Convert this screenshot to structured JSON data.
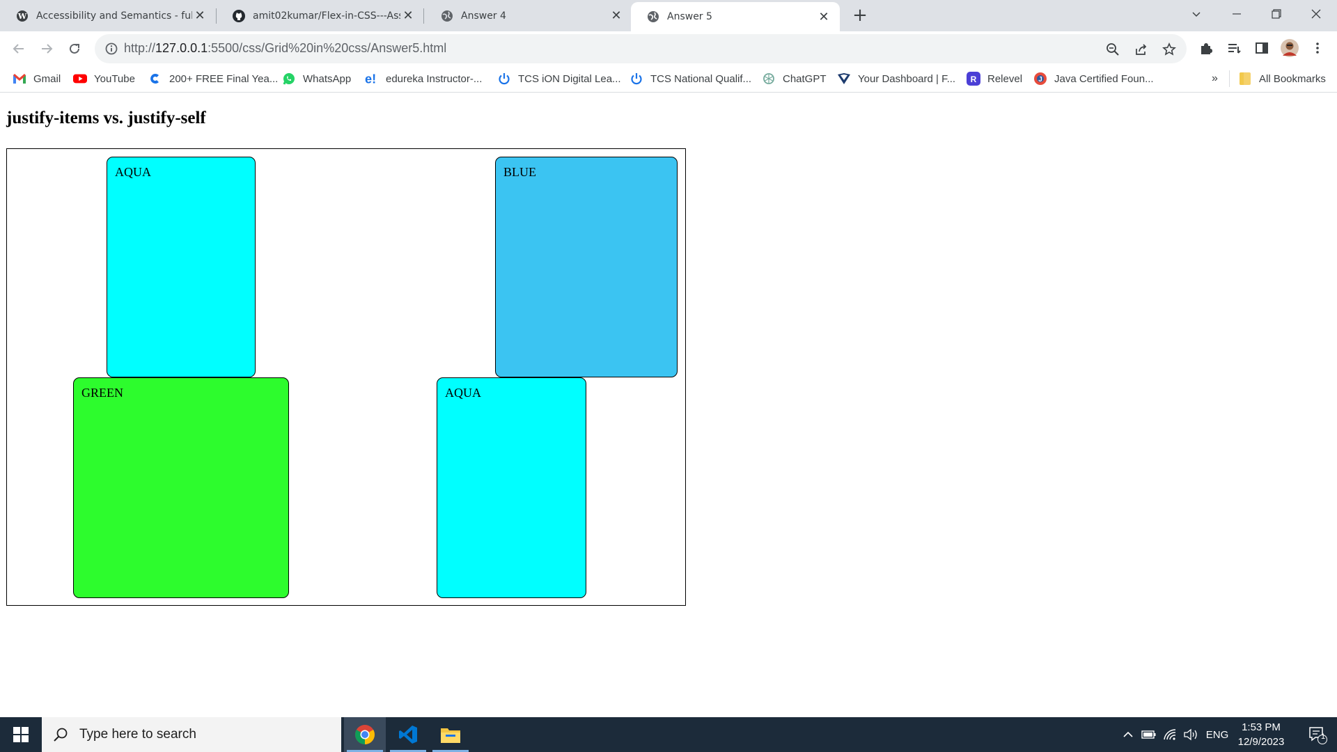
{
  "browser": {
    "tabs": [
      {
        "title": "Accessibility and Semantics - full",
        "favicon": "wordpress-icon",
        "active": false
      },
      {
        "title": "amit02kumar/Flex-in-CSS---Ass",
        "favicon": "github-icon",
        "active": false
      },
      {
        "title": "Answer 4",
        "favicon": "globe-icon",
        "active": false
      },
      {
        "title": "Answer 5",
        "favicon": "globe-icon",
        "active": true
      }
    ],
    "new_tab_label": "+",
    "address": {
      "prefix": "http://",
      "host": "127.0.0.1",
      "rest": ":5500/css/Grid%20in%20css/Answer5.html"
    },
    "bookmarks": [
      {
        "label": "Gmail",
        "icon": "gmail-icon"
      },
      {
        "label": "YouTube",
        "icon": "youtube-icon"
      },
      {
        "label": "200+ FREE Final Yea...",
        "icon": "c-logo-icon"
      },
      {
        "label": "WhatsApp",
        "icon": "whatsapp-icon"
      },
      {
        "label": "edureka Instructor-...",
        "icon": "edureka-icon"
      },
      {
        "label": "TCS iON Digital Lea...",
        "icon": "power-icon"
      },
      {
        "label": "TCS National Qualif...",
        "icon": "power-icon"
      },
      {
        "label": "ChatGPT",
        "icon": "chatgpt-icon"
      },
      {
        "label": "Your Dashboard | F...",
        "icon": "dashboard-icon"
      },
      {
        "label": "Relevel",
        "icon": "relevel-icon"
      },
      {
        "label": "Java Certified Foun...",
        "icon": "java-icon"
      }
    ],
    "overflow_label": "»",
    "all_bookmarks_label": "All Bookmarks"
  },
  "page": {
    "heading": "justify-items vs. justify-self",
    "boxes": [
      {
        "label": "AQUA",
        "color": "#00ffff"
      },
      {
        "label": "BLUE",
        "color": "#3bc4f2"
      },
      {
        "label": "GREEN",
        "color": "#2dfc2d"
      },
      {
        "label": "AQUA",
        "color": "#00ffff"
      }
    ]
  },
  "taskbar": {
    "search_placeholder": "Type here to search",
    "language": "ENG",
    "time": "1:53 PM",
    "date": "12/9/2023",
    "notification_count": "1"
  }
}
